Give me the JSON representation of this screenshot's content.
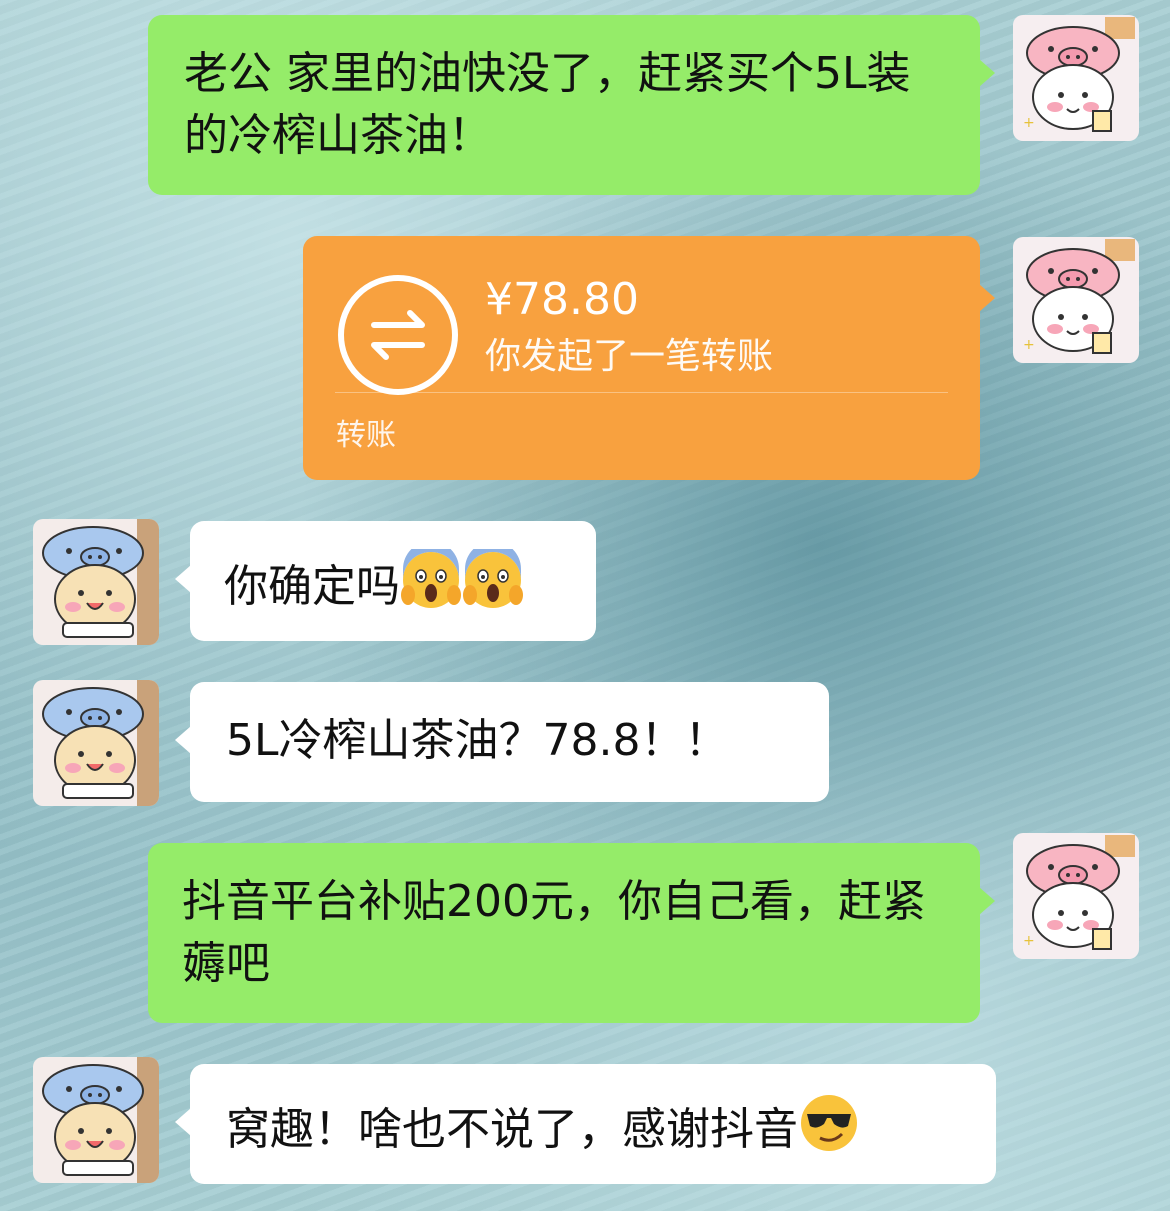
{
  "messages": [
    {
      "side": "right",
      "type": "text",
      "text": "老公 家里的油快没了，赶紧买个5L装的冷榨山茶油！"
    },
    {
      "side": "right",
      "type": "transfer",
      "amount": "¥78.80",
      "desc": "你发起了一笔转账",
      "footer": "转账"
    },
    {
      "side": "left",
      "type": "text",
      "text": "你确定吗",
      "emoji": [
        "scream-emoji",
        "scream-emoji"
      ]
    },
    {
      "side": "left",
      "type": "text",
      "text": "5L冷榨山茶油？78.8！！"
    },
    {
      "side": "right",
      "type": "text",
      "text": "抖音平台补贴200元，你自己看，赶紧薅吧"
    },
    {
      "side": "left",
      "type": "text",
      "text": "窝趣！啥也不说了，感谢抖音",
      "emoji": [
        "sunglasses-emoji"
      ]
    }
  ],
  "colors": {
    "sent_bubble": "#95ec69",
    "received_bubble": "#ffffff",
    "transfer_card": "#f8a13f"
  }
}
